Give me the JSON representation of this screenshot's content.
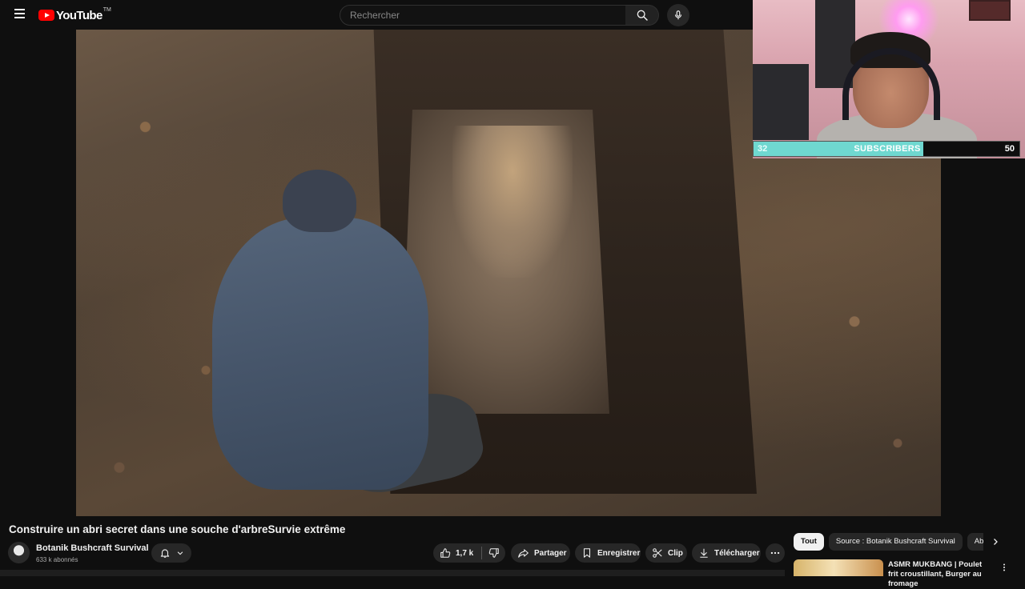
{
  "header": {
    "logo_text": "YouTube",
    "logo_tm": "TM",
    "search_placeholder": "Rechercher"
  },
  "webcam_overlay": {
    "subscriber_goal": {
      "current": "32",
      "label": "SUBSCRIBERS",
      "target": "50",
      "progress_fraction": 0.64,
      "fill_color": "#6fd8d0"
    }
  },
  "video": {
    "title": "Construire un abri secret dans une souche d'arbreSurvie extrême"
  },
  "channel": {
    "name": "Botanik Bushcraft Survival",
    "subscribers": "633 k abonnés"
  },
  "actions": {
    "like_count": "1,7 k",
    "share_label": "Partager",
    "save_label": "Enregistrer",
    "clip_label": "Clip",
    "download_label": "Télécharger"
  },
  "chips": [
    "Tout",
    "Source : Botanik Bushcraft Survival",
    "Abri"
  ],
  "suggestion": {
    "title": "ASMR MUKBANG | Poulet frit croustillant, Burger au fromage"
  },
  "icons": [
    "menu-icon",
    "youtube-logo",
    "search-icon",
    "mic-icon",
    "bell-icon",
    "chevron-down-icon",
    "like-icon",
    "dislike-icon",
    "share-icon",
    "save-icon",
    "clip-icon",
    "download-icon",
    "more-icon",
    "chevron-right-icon",
    "more-vert-icon"
  ],
  "colors": {
    "background": "#0f0f0f",
    "brand_red": "#ff0000",
    "pill_bg": "#272727",
    "text": "#f1f1f1"
  }
}
